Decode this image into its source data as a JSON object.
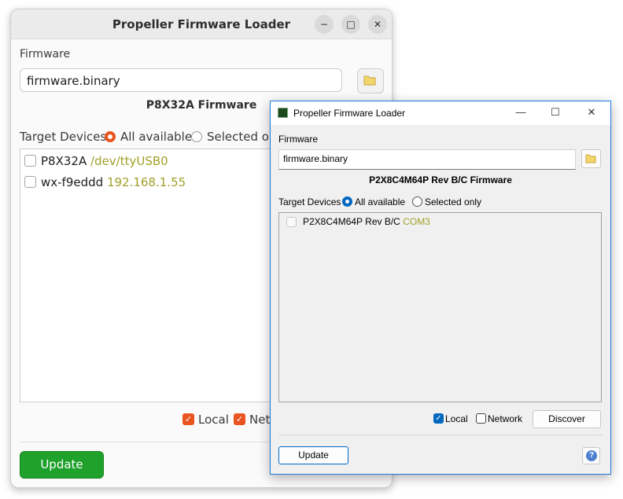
{
  "back_window": {
    "title": "Propeller Firmware Loader",
    "controls": {
      "minimize": "−",
      "maximize": "□",
      "close": "✕"
    },
    "firmware_label": "Firmware",
    "firmware_value": "firmware.binary",
    "firmware_type": "P8X32A Firmware",
    "target_label": "Target Devices",
    "radio_all": "All available",
    "radio_selected": "Selected onl",
    "devices": [
      {
        "name": "P8X32A",
        "port": "/dev/ttyUSB0"
      },
      {
        "name": "wx-f9eddd",
        "port": "192.168.1.55"
      }
    ],
    "local_label": "Local",
    "network_label": "Netw",
    "update_label": "Update",
    "accent_color": "#e95420",
    "update_color": "#1fa12c"
  },
  "front_window": {
    "title": "Propeller Firmware Loader",
    "controls": {
      "minimize": "—",
      "maximize": "☐",
      "close": "✕"
    },
    "firmware_label": "Firmware",
    "firmware_value": "firmware.binary",
    "firmware_type": "P2X8C4M64P Rev B/C Firmware",
    "target_label": "Target Devices",
    "radio_all": "All available",
    "radio_selected": "Selected only",
    "devices": [
      {
        "name": "P2X8C4M64P Rev B/C",
        "port": "COM3"
      }
    ],
    "local_label": "Local",
    "network_label": "Network",
    "discover_label": "Discover",
    "update_label": "Update",
    "help_glyph": "?",
    "accent_color": "#0067c0"
  }
}
